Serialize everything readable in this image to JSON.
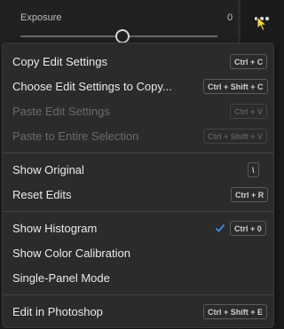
{
  "panel": {
    "exposure_label": "Exposure",
    "exposure_value": "0"
  },
  "menu": {
    "items": [
      {
        "label": "Copy Edit Settings",
        "shortcut": "Ctrl + C",
        "enabled": true
      },
      {
        "label": "Choose Edit Settings to Copy...",
        "shortcut": "Ctrl + Shift + C",
        "enabled": true
      },
      {
        "label": "Paste Edit Settings",
        "shortcut": "Ctrl + V",
        "enabled": false
      },
      {
        "label": "Paste to Entire Selection",
        "shortcut": "Ctrl + Shift + V",
        "enabled": false
      },
      {
        "label": "Show Original",
        "shortcut": "\\",
        "enabled": true
      },
      {
        "label": "Reset Edits",
        "shortcut": "Ctrl + R",
        "enabled": true
      },
      {
        "label": "Show Histogram",
        "shortcut": "Ctrl + 0",
        "enabled": true,
        "checked": true
      },
      {
        "label": "Show Color Calibration",
        "shortcut": "",
        "enabled": true
      },
      {
        "label": "Single-Panel Mode",
        "shortcut": "",
        "enabled": true
      },
      {
        "label": "Edit in Photoshop",
        "shortcut": "Ctrl + Shift + E",
        "enabled": true
      }
    ]
  },
  "colors": {
    "accent_check": "#3d8ee8",
    "cursor": "#f5d43a"
  },
  "icons": {
    "more": "more-dots-icon",
    "check": "checkmark-icon",
    "cursor": "mouse-pointer-icon"
  }
}
